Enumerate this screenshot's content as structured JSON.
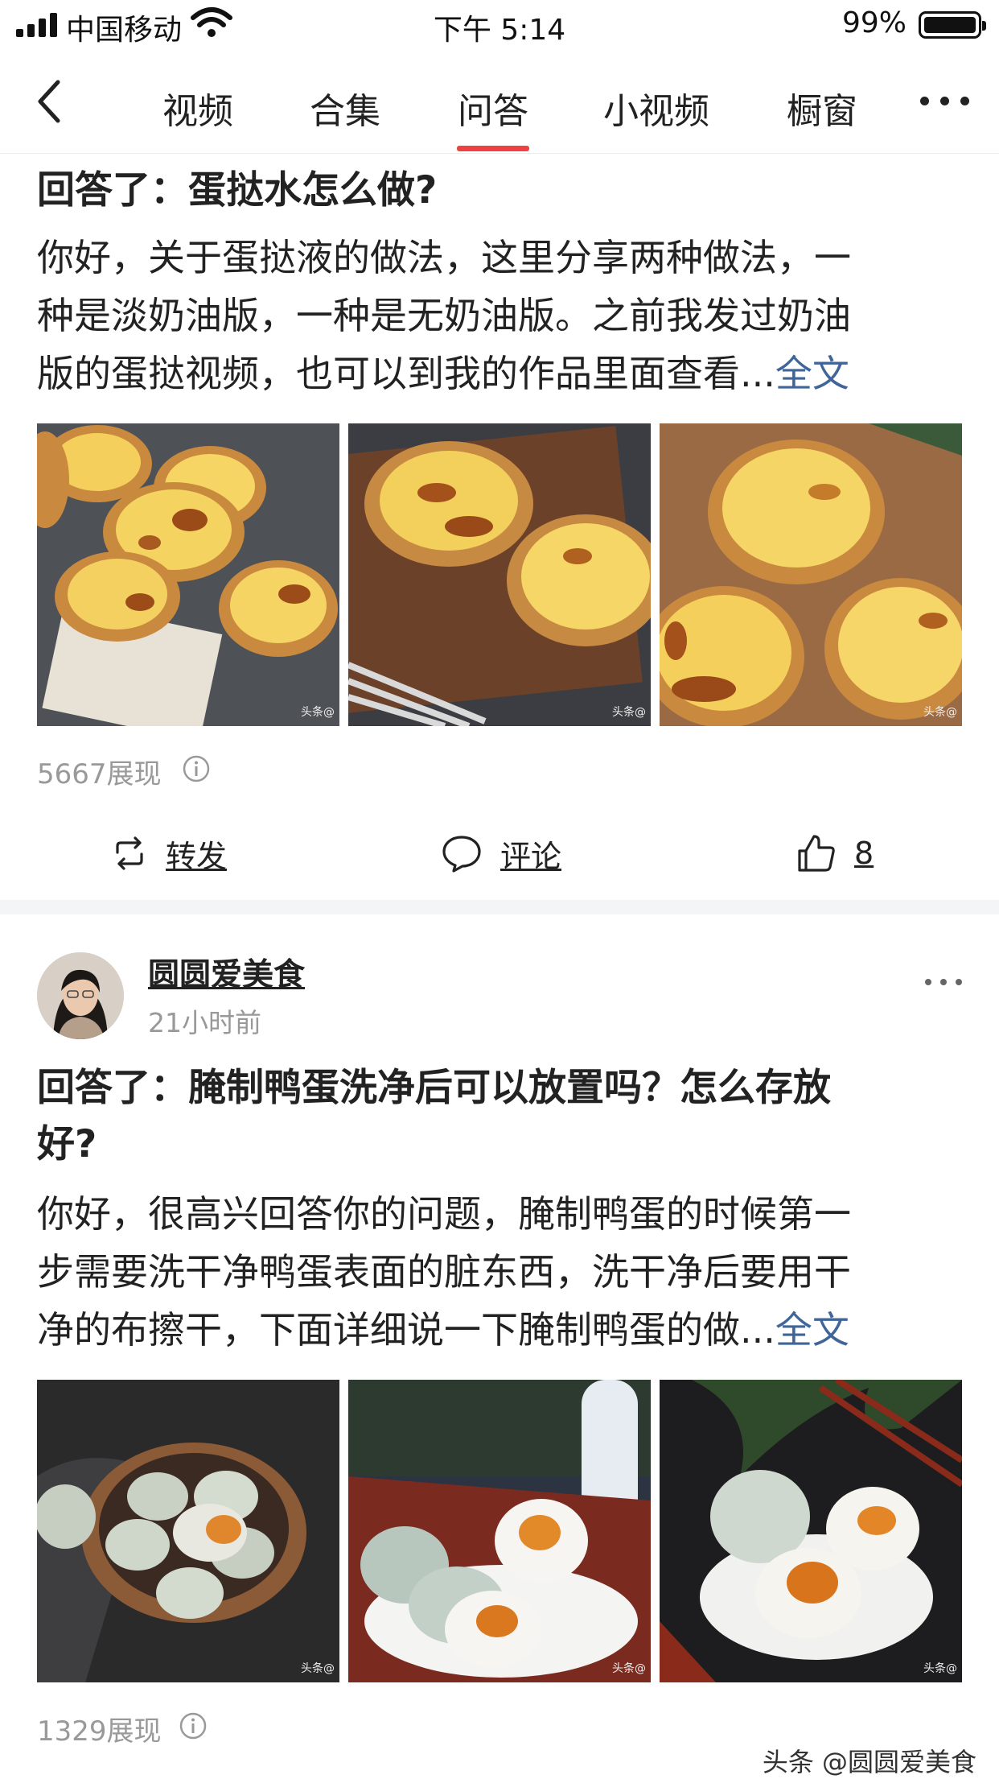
{
  "status_bar": {
    "carrier": "中国移动",
    "time": "下午 5:14",
    "battery": "99%"
  },
  "nav": {
    "tabs": [
      "视频",
      "合集",
      "问答",
      "小视频",
      "橱窗"
    ],
    "active_tab": "问答"
  },
  "posts": [
    {
      "title": "回答了：蛋挞水怎么做?",
      "body_lines": [
        "你好，关于蛋挞液的做法，这里分享两种做法，一",
        "种是淡奶油版，一种是无奶油版。之前我发过奶油",
        "版的蛋挞视频，也可以到我的作品里面查看..."
      ],
      "full_text_link": "全文",
      "images": [
        "egg-tarts-on-plate",
        "egg-tarts-on-wooden-board",
        "egg-tarts-closeup"
      ],
      "image_watermark": "头条@",
      "views": "5667展现",
      "actions": {
        "share": "转发",
        "comment": "评论",
        "like_count": "8"
      }
    },
    {
      "author": "圆圆爱美食",
      "time": "21小时前",
      "title_lines": [
        "回答了：腌制鸭蛋洗净后可以放置吗？怎么存放",
        "好?"
      ],
      "body_lines": [
        "你好，很高兴回答你的问题，腌制鸭蛋的时候第一",
        "步需要洗干净鸭蛋表面的脏东西，洗干净后要用干",
        "净的布擦干，下面详细说一下腌制鸭蛋的做..."
      ],
      "full_text_link": "全文",
      "images": [
        "salted-eggs-in-bowl",
        "salted-eggs-halved",
        "salted-eggs-dark-background"
      ],
      "image_watermark": "头条@",
      "views": "1329展现"
    }
  ],
  "watermark": "头条 @圆圆爱美食"
}
